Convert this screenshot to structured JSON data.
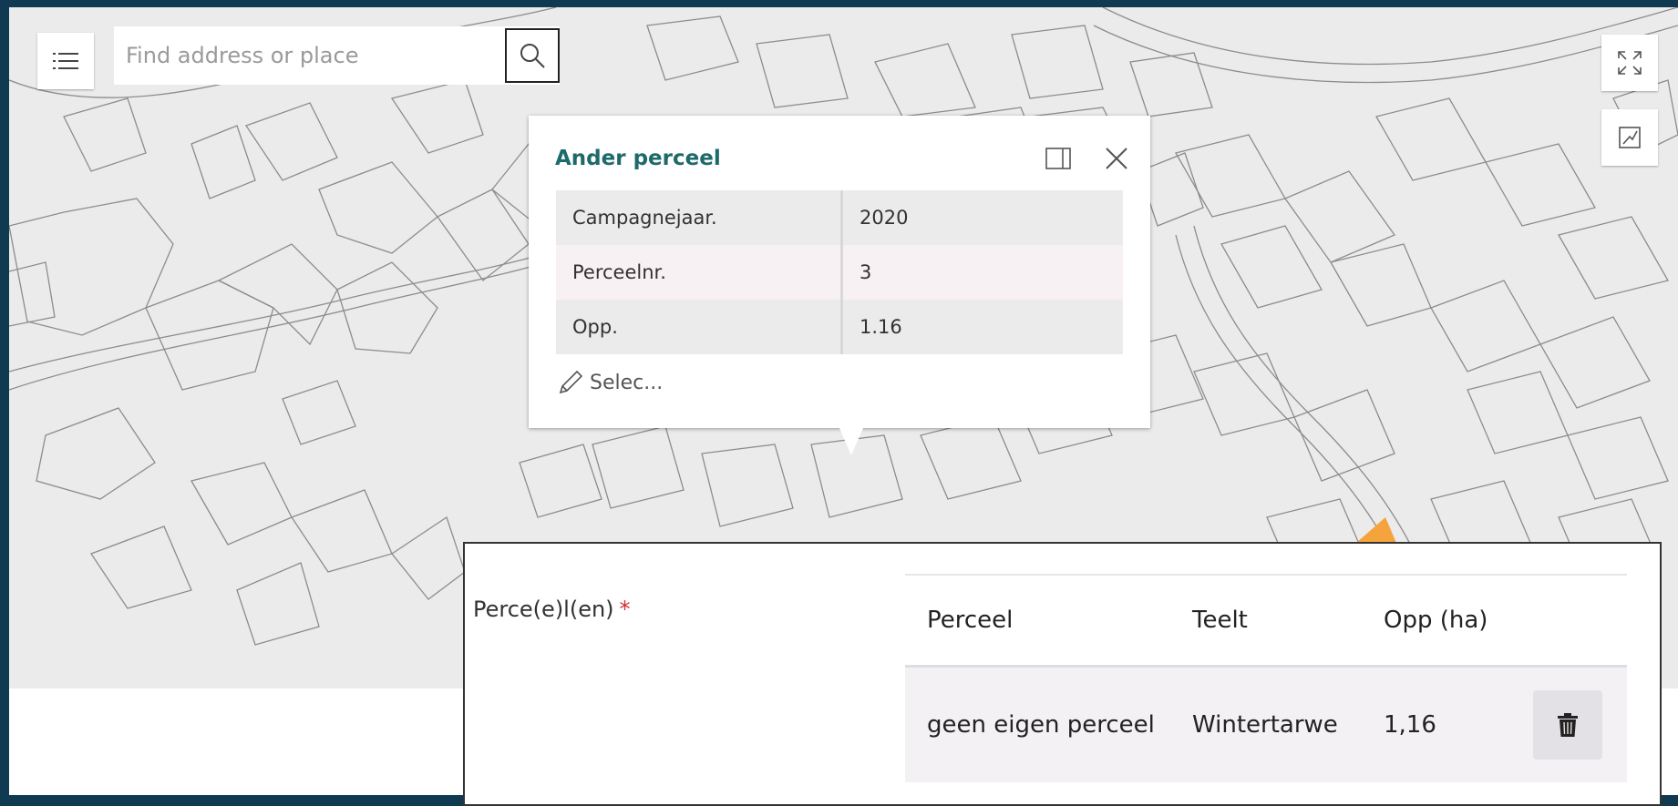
{
  "search": {
    "placeholder": "Find address or place"
  },
  "popup": {
    "title": "Ander perceel",
    "attributes": [
      {
        "key": "Campagnejaar.",
        "value": "2020"
      },
      {
        "key": "Perceelnr.",
        "value": "3"
      },
      {
        "key": "Opp.",
        "value": "1.16"
      }
    ],
    "action_label": "Selec..."
  },
  "form": {
    "label": "Perce(e)l(en)",
    "required_mark": "*",
    "table": {
      "headers": [
        "Perceel",
        "Teelt",
        "Opp (ha)"
      ],
      "rows": [
        {
          "perceel": "geen eigen perceel",
          "teelt": "Wintertarwe",
          "opp": "1,16"
        }
      ]
    }
  },
  "colors": {
    "frame": "#0f3a52",
    "map_bg": "#ecebec",
    "parcel_stroke": "#8c8c8c",
    "popup_title": "#1e6a6a",
    "highlight_parcel": "#f5a33c",
    "required": "#d32f2f"
  },
  "icons": [
    "list-icon",
    "search-icon",
    "fullscreen-icon",
    "measure-icon",
    "dock-icon",
    "close-icon",
    "pencil-icon",
    "trash-icon"
  ]
}
